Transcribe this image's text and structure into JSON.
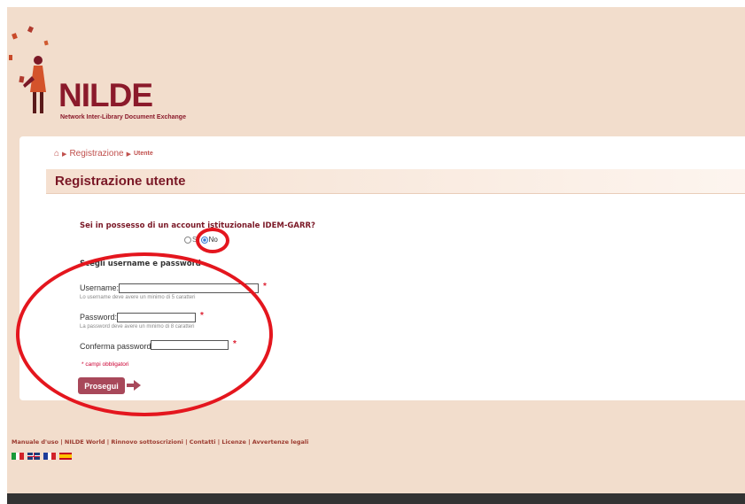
{
  "logo": {
    "title": "NILDE",
    "subtitle": "Network Inter-Library Document Exchange"
  },
  "breadcrumb": {
    "home_icon": "home-icon",
    "items": [
      "Registrazione",
      "Utente"
    ]
  },
  "page_title": "Registrazione utente",
  "idem": {
    "question": "Sei in possesso di un account istituzionale IDEM-GARR?",
    "options": [
      {
        "label": "Sì",
        "checked": false
      },
      {
        "label": "No",
        "checked": true
      }
    ]
  },
  "credentials": {
    "section_title": "Scegli username e password",
    "username": {
      "label": "Username:",
      "value": "",
      "hint": "Lo username deve avere un minimo di 5 caratteri"
    },
    "password": {
      "label": "Password:",
      "value": "",
      "hint": "La password deve avere un minimo di 8 caratteri"
    },
    "confirm": {
      "label": "Conferma password:",
      "value": ""
    },
    "required_marker": "*",
    "required_note": "* campi obbligatori"
  },
  "submit_label": "Prosegui",
  "footer": {
    "links": "Manuale d'uso | NILDE World | Rinnovo sottoscrizioni | Contatti | Licenze | Avvertenze legali",
    "languages": [
      "it",
      "en",
      "fr",
      "es"
    ]
  },
  "colors": {
    "background": "#f2ddcc",
    "brand": "#8b1a2b",
    "button": "#a8485a",
    "annotation": "#e4161e"
  }
}
